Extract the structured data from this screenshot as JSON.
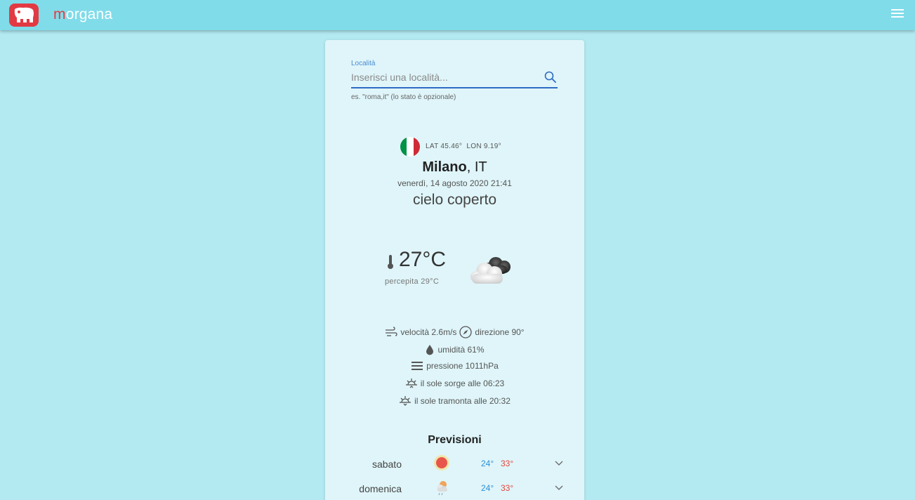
{
  "app": {
    "brand_initial": "m",
    "brand_rest": "organa",
    "colors": {
      "appbar": "#80dce9",
      "background": "#b3e9f1",
      "card": "#dff5f9",
      "accent": "#e23a43",
      "link": "#2e6bc4"
    }
  },
  "search": {
    "label": "Località",
    "placeholder": "Inserisci una località...",
    "value": "",
    "hint": "es. \"roma,it\" (lo stato è opzionale)"
  },
  "location": {
    "lat_label": "LAT 45.46°",
    "lon_label": "LON 9.19°",
    "city": "Milano",
    "country": " IT",
    "datetime": "venerdì, 14 agosto 2020 21:41",
    "condition": "cielo coperto",
    "flag_colors": [
      "#009246",
      "#ffffff",
      "#ce2b37"
    ]
  },
  "current": {
    "temperature": "27°C",
    "feels_like": "percepita 29°C",
    "icon": "overcast-clouds-icon"
  },
  "details": {
    "wind_speed": "velocità 2.6m/s",
    "wind_direction": "direzione 90°",
    "humidity": "umidità 61%",
    "pressure": "pressione 1011hPa",
    "sunrise": "il sole sorge alle 06:23",
    "sunset": "il sole tramonta alle 20:32"
  },
  "forecast": {
    "title": "Previsioni",
    "days": [
      {
        "day": "sabato",
        "min": "24°",
        "max": "33°",
        "icon": "sun-icon"
      },
      {
        "day": "domenica",
        "min": "24°",
        "max": "33°",
        "icon": "sun-cloud-rain-icon"
      }
    ]
  }
}
